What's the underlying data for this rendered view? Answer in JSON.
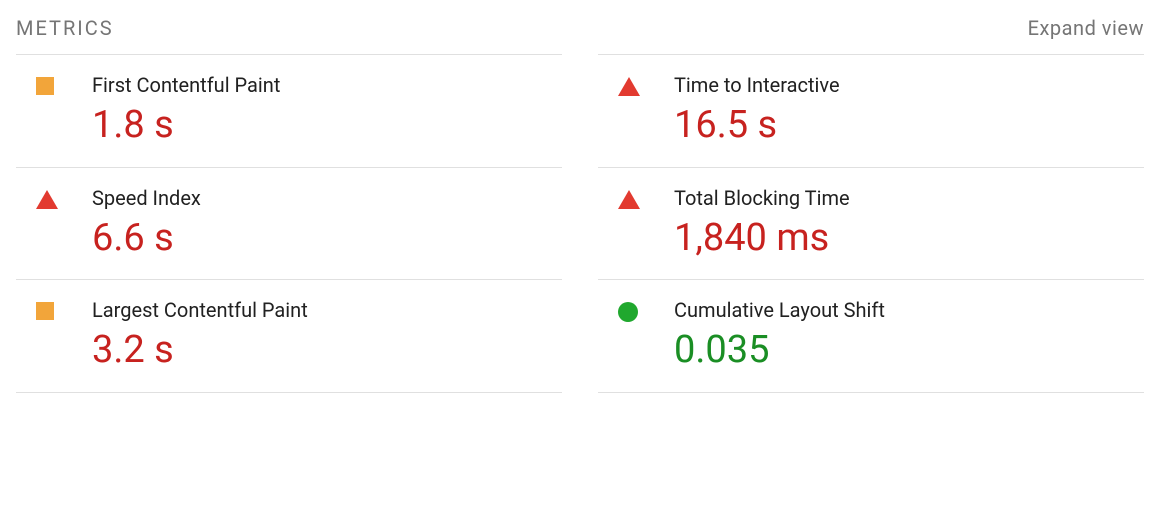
{
  "header": {
    "title": "METRICS",
    "expand_label": "Expand view"
  },
  "metrics": {
    "left": [
      {
        "icon": "square",
        "label": "First Contentful Paint",
        "value": "1.8 s",
        "value_color": "red"
      },
      {
        "icon": "triangle",
        "label": "Speed Index",
        "value": "6.6 s",
        "value_color": "red"
      },
      {
        "icon": "square",
        "label": "Largest Contentful Paint",
        "value": "3.2 s",
        "value_color": "red"
      }
    ],
    "right": [
      {
        "icon": "triangle",
        "label": "Time to Interactive",
        "value": "16.5 s",
        "value_color": "red"
      },
      {
        "icon": "triangle",
        "label": "Total Blocking Time",
        "value": "1,840 ms",
        "value_color": "red"
      },
      {
        "icon": "circle",
        "label": "Cumulative Layout Shift",
        "value": "0.035",
        "value_color": "green"
      }
    ]
  }
}
